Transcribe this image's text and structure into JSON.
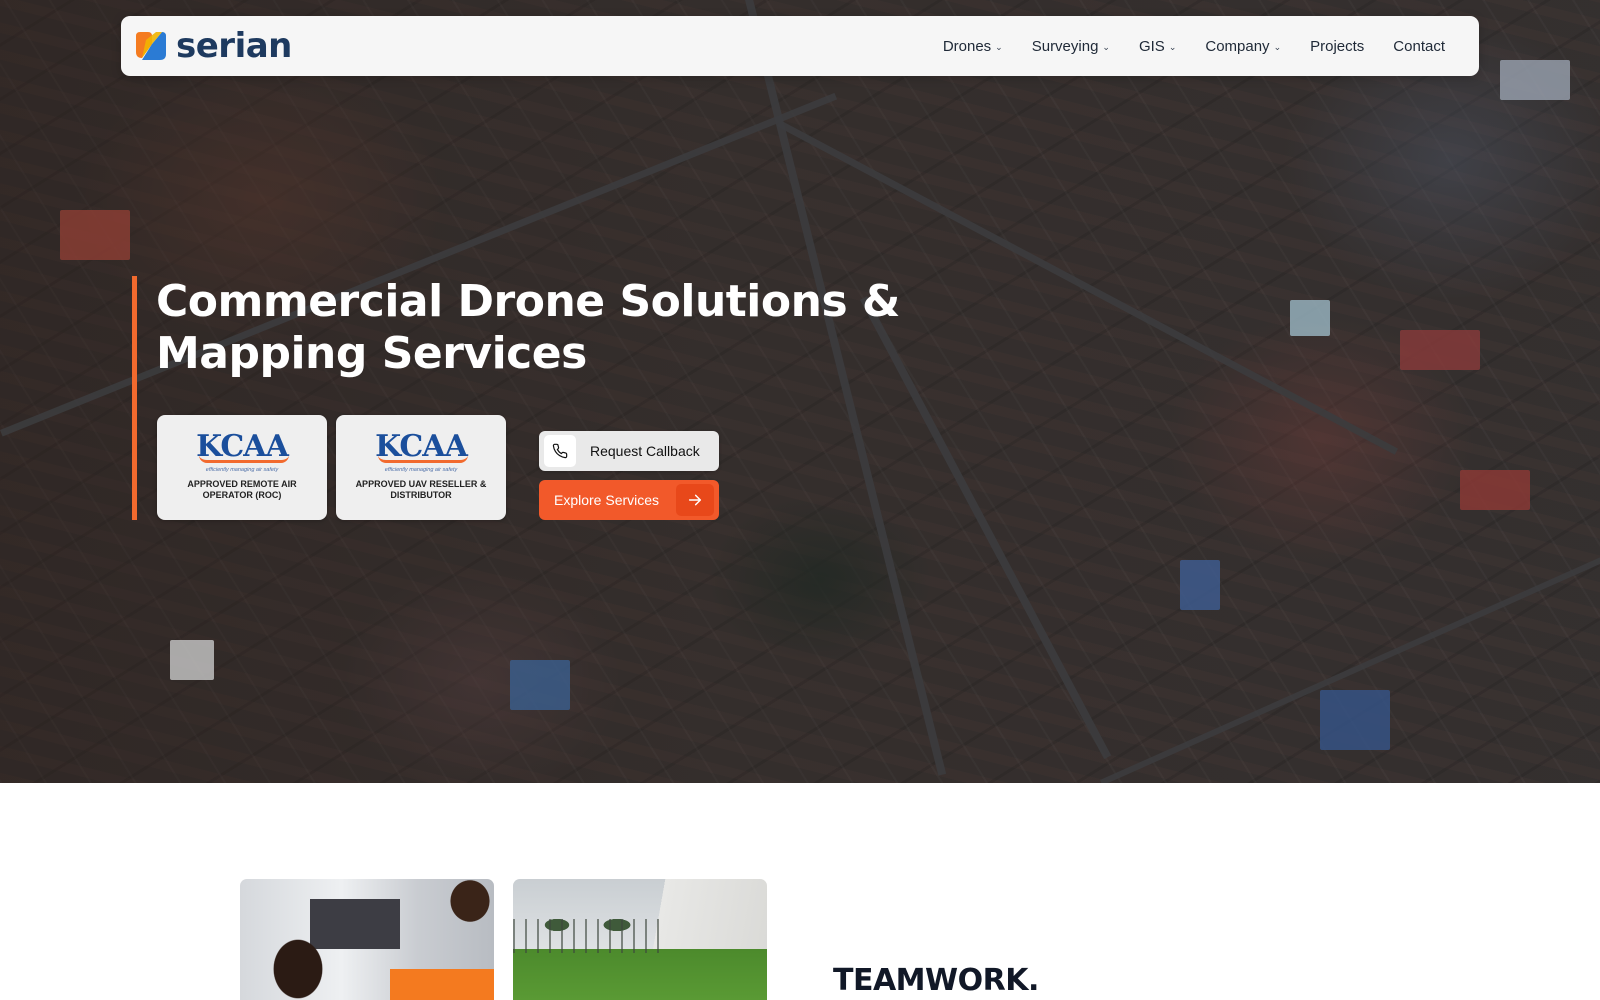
{
  "brand": {
    "name": "serian",
    "colors": {
      "accent": "#f26a2e",
      "navy": "#1e3a5f",
      "logo_orange": "#f47b20",
      "logo_blue": "#2b7bd4"
    }
  },
  "nav": {
    "items": [
      {
        "label": "Drones",
        "has_dropdown": true
      },
      {
        "label": "Surveying",
        "has_dropdown": true
      },
      {
        "label": "GIS",
        "has_dropdown": true
      },
      {
        "label": "Company",
        "has_dropdown": true
      },
      {
        "label": "Projects",
        "has_dropdown": false
      },
      {
        "label": "Contact",
        "has_dropdown": false
      }
    ],
    "dropdown_icon": "chevron-down-icon"
  },
  "hero": {
    "headline": "Commercial Drone Solutions & Mapping Services",
    "badges": [
      {
        "logo_text": "KCAA",
        "tagline": "efficiently managing air safety",
        "label": "APPROVED REMOTE AIR OPERATOR (ROC)"
      },
      {
        "logo_text": "KCAA",
        "tagline": "efficiently managing air safety",
        "label": "APPROVED UAV RESELLER & DISTRIBUTOR"
      }
    ],
    "buttons": {
      "callback": {
        "label": "Request Callback",
        "icon": "phone-icon"
      },
      "explore": {
        "label": "Explore Services",
        "icon": "arrow-right-icon"
      }
    }
  },
  "section": {
    "heading": "TEAMWORK."
  }
}
